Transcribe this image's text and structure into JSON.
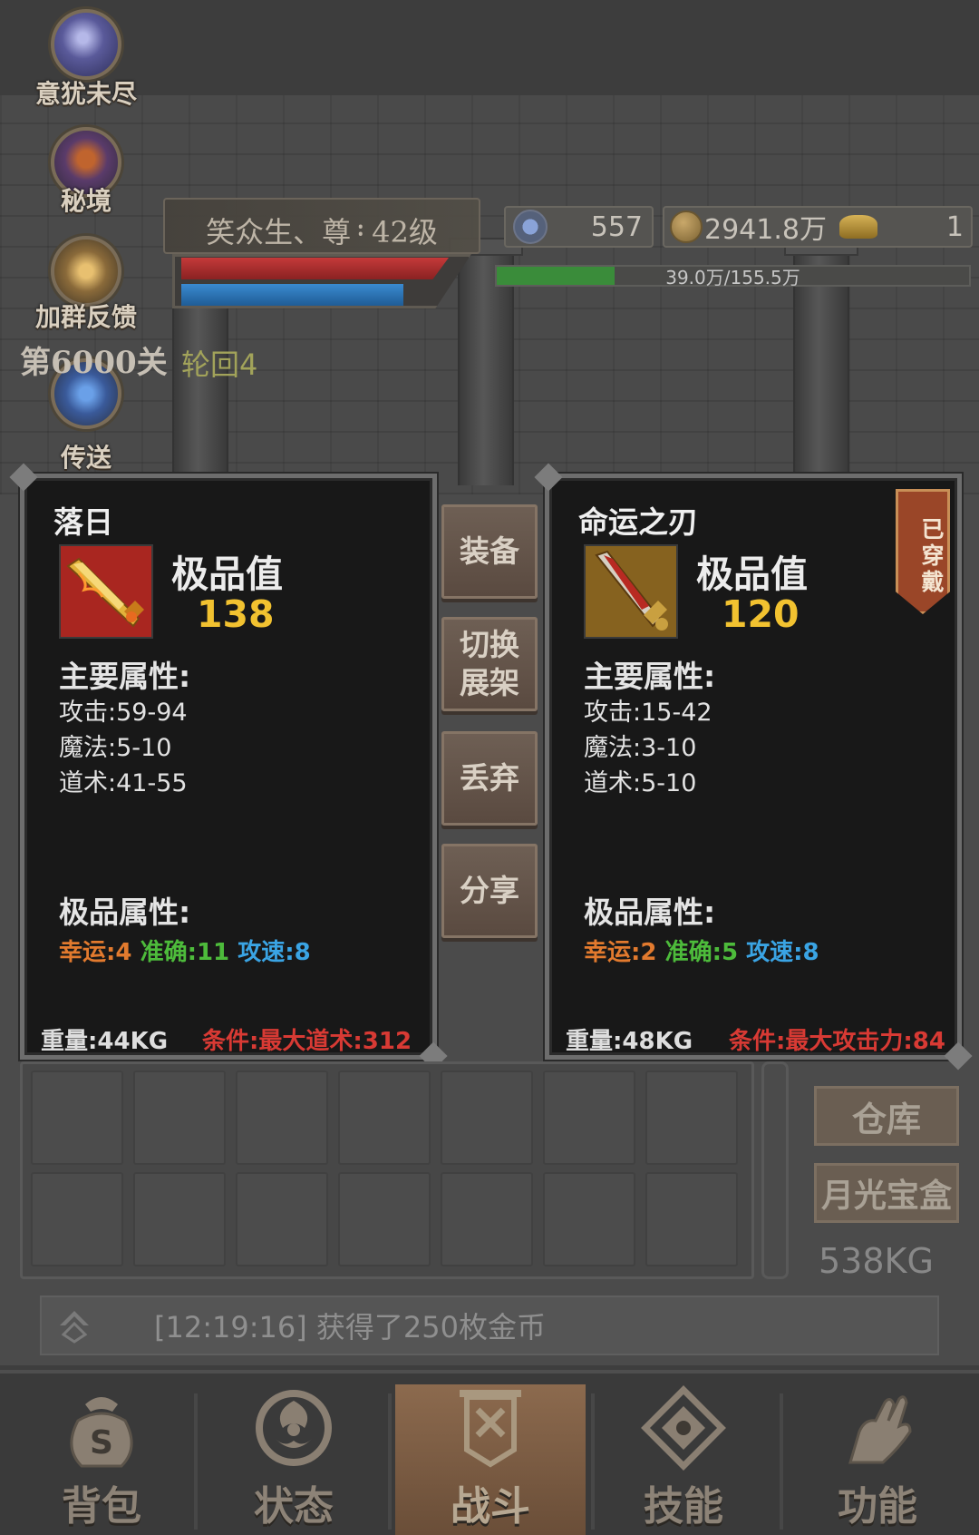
{
  "side_menu": [
    {
      "label": "意犹未尽",
      "icon": "portal-orb-icon",
      "color": "#6b66a6"
    },
    {
      "label": "秘境",
      "icon": "demon-armor-icon",
      "color": "#8a5a2e"
    },
    {
      "label": "加群反馈",
      "icon": "swirl-orb-icon",
      "color": "#8a6a3a"
    },
    {
      "label": "传送",
      "icon": "blue-flame-icon",
      "color": "#4a66a8"
    }
  ],
  "player": {
    "name_level": "笑众生、尊᠄ 42级",
    "hp_percent": 95,
    "mp_percent": 80
  },
  "resources": {
    "gems": "557",
    "gold": "2941.8万",
    "ingots": "1"
  },
  "exp": {
    "text": "39.0万/155.5万",
    "fraction": 0.25
  },
  "stage": {
    "level": "第6000关",
    "cycle": "轮回4"
  },
  "left_card": {
    "name": "落日",
    "icon": "flaming-sword-icon",
    "quality_label": "极品值",
    "quality_value": "138",
    "main_title": "主要属性:",
    "stats": [
      "攻击:59-94",
      "魔法:5-10",
      "道术:41-55"
    ],
    "excel_title": "极品属性:",
    "luck": "幸运:4",
    "accuracy": "准确:11",
    "speed": "攻速:8",
    "weight": "重量:44KG",
    "condition": "条件:最大道术:312"
  },
  "right_card": {
    "name": "命运之刃",
    "icon": "golden-blade-icon",
    "quality_label": "极品值",
    "quality_value": "120",
    "main_title": "主要属性:",
    "stats": [
      "攻击:15-42",
      "魔法:3-10",
      "道术:5-10"
    ],
    "excel_title": "极品属性:",
    "luck": "幸运:2",
    "accuracy": "准确:5",
    "speed": "攻速:8",
    "weight": "重量:48KG",
    "condition": "条件:最大攻击力:84",
    "equipped_tag": "已穿戴"
  },
  "actions": {
    "equip": "装备",
    "switch": "切换展架",
    "discard": "丢弃",
    "share": "分享"
  },
  "inventory": {
    "warehouse": "仓库",
    "moonlight_box": "月光宝盒",
    "capacity": "538KG"
  },
  "log": {
    "message": "[12:19:16] 获得了250枚金币"
  },
  "nav": [
    {
      "label": "背包",
      "icon": "bag-icon"
    },
    {
      "label": "状态",
      "icon": "status-emblem-icon"
    },
    {
      "label": "战斗",
      "icon": "battle-banner-icon",
      "active": true
    },
    {
      "label": "技能",
      "icon": "skill-diamond-icon"
    },
    {
      "label": "功能",
      "icon": "hand-icon"
    }
  ]
}
